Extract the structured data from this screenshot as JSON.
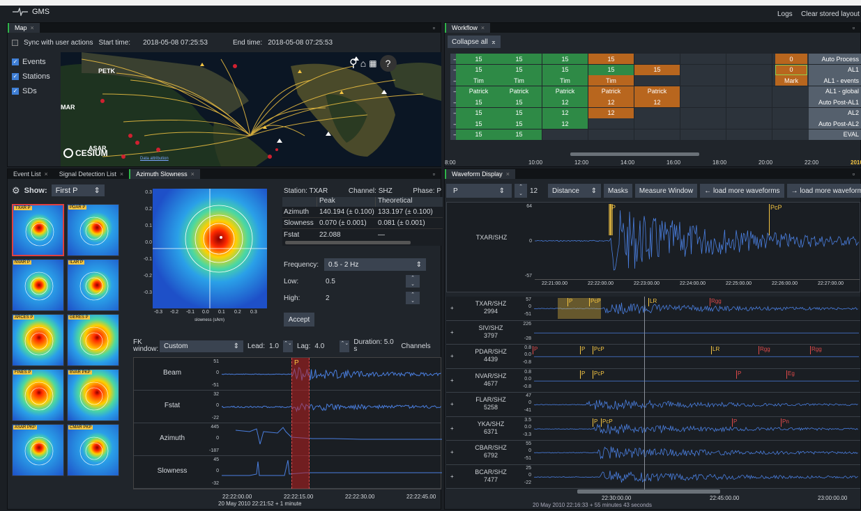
{
  "app": {
    "title": "GMS",
    "logs": "Logs",
    "clear": "Clear stored layout"
  },
  "map": {
    "tab": "Map",
    "sync_label": "Sync with user actions",
    "start_label": "Start time:",
    "start_value": "2018-05-08 07:25:53",
    "end_label": "End time:",
    "end_value": "2018-05-08 07:25:53",
    "layers": [
      "Events",
      "Stations",
      "SDs"
    ],
    "cesium": "CESIUM",
    "attribution": "Data attribution",
    "station_labels": [
      "PETK",
      "MAR",
      "ASAR",
      "ASAR"
    ]
  },
  "workflow": {
    "tab": "Workflow",
    "collapse": "Collapse all",
    "rows": [
      {
        "name": "Auto Process",
        "cells": [
          "15",
          "15",
          "15",
          "15",
          "",
          "",
          "",
          "",
          "0"
        ]
      },
      {
        "name": "AL1",
        "cells": [
          "15",
          "15",
          "15",
          "15",
          "15",
          "",
          "",
          "",
          "0"
        ]
      },
      {
        "name": "AL1 - events",
        "cells": [
          "Tim",
          "Tim",
          "Tim",
          "Tim",
          "",
          "",
          "",
          "",
          "Mark"
        ]
      },
      {
        "name": "AL1 - global",
        "cells": [
          "Patrick",
          "Patrick",
          "Patrick",
          "Patrick",
          "Patrick",
          "",
          "",
          "",
          ""
        ]
      },
      {
        "name": "Auto Post-AL1",
        "cells": [
          "15",
          "15",
          "12",
          "12",
          "12",
          "",
          "",
          "",
          ""
        ]
      },
      {
        "name": "AL2",
        "cells": [
          "15",
          "15",
          "12",
          "12",
          "",
          "",
          "",
          "",
          ""
        ]
      },
      {
        "name": "Auto Post-AL2",
        "cells": [
          "15",
          "15",
          "12",
          "",
          "",
          "",
          "",
          "",
          ""
        ]
      },
      {
        "name": "EVAL",
        "cells": [
          "15",
          "15",
          "",
          "",
          "",
          "",
          "",
          "",
          ""
        ]
      }
    ],
    "times": [
      "8:00",
      "10:00",
      "12:00",
      "14:00",
      "16:00",
      "18:00",
      "20:00",
      "22:00",
      "2010"
    ]
  },
  "left_tabs": [
    "Event List",
    "Signal Detection List",
    "Azimuth Slowness"
  ],
  "azslow": {
    "show_label": "Show:",
    "show_value": "First P",
    "thumbs": [
      "TXAR P",
      "PDAR P",
      "NVAR P",
      "ILAR P",
      "ARCES P",
      "GERES P",
      "FINES P",
      "BVAR PKP",
      "ASAR PKP",
      "CMAR PKP"
    ],
    "yticks": [
      "0.3",
      "0.2",
      "0.1",
      "0.0",
      "-0.1",
      "-0.2",
      "-0.3"
    ],
    "xticks": [
      "-0.3",
      "-0.2",
      "-0.1",
      "0.0",
      "0.1",
      "0.2",
      "0.3"
    ],
    "xunit": "slowness (s/km)",
    "station": "Station: TXAR",
    "channel": "Channel: SHZ",
    "phase": "Phase: P",
    "table": {
      "headers": [
        "",
        "Peak",
        "Theoretical"
      ],
      "rows": [
        [
          "Azimuth",
          "140.194 (± 0.100)",
          "133.197 (± 0.100)"
        ],
        [
          "Slowness",
          "0.070 (± 0.001)",
          "0.081 (± 0.001)"
        ],
        [
          "Fstat",
          "22.088",
          "—"
        ]
      ]
    },
    "freq_label": "Frequency:",
    "freq_value": "0.5 - 2 Hz",
    "low_label": "Low:",
    "low_value": "0.5",
    "high_label": "High:",
    "high_value": "2",
    "accept": "Accept",
    "fk_label": "FK window:",
    "fk_value": "Custom",
    "lead_label": "Lead:",
    "lead_value": "1.0",
    "lag_label": "Lag:",
    "lag_value": "4.0",
    "duration": "Duration: 5.0 s",
    "channels": "Channels",
    "traces": [
      {
        "name": "Beam",
        "ticks": [
          "51",
          "0",
          "-51"
        ]
      },
      {
        "name": "Fstat",
        "ticks": [
          "32",
          "0",
          "-22"
        ]
      },
      {
        "name": "Azimuth",
        "ticks": [
          "445",
          "0",
          "-187"
        ]
      },
      {
        "name": "Slowness",
        "ticks": [
          "45",
          "0",
          "-32"
        ]
      }
    ],
    "marker": "P",
    "times": [
      "22:22:00.00",
      "22:22:15.00",
      "22:22:30.00",
      "22:22:45.00"
    ],
    "footer": "20 May 2010 22:21:52 + 1 minute"
  },
  "waveform": {
    "tab": "Waveform Display",
    "phase": "P",
    "count": "12",
    "sort": "Distance",
    "masks": "Masks",
    "measure": "Measure Window",
    "load_prev": "← load more waveforms",
    "load_next": "→ load more waveforms",
    "top": {
      "name": "TXAR/SHZ",
      "ticks": [
        "64",
        "0",
        "-57"
      ],
      "markers": [
        "P",
        "PcP"
      ],
      "times": [
        "22:21:00.00",
        "22:22:00.00",
        "22:23:00.00",
        "22:24:00.00",
        "22:25:00.00",
        "22:26:00.00",
        "22:27:00.00"
      ]
    },
    "channels": [
      {
        "name": "TXAR/SHZ",
        "dist": "2994",
        "ticks": [
          "57",
          "0",
          "-51"
        ],
        "markers": [
          "P",
          "PcP",
          "LR",
          "Rgg"
        ]
      },
      {
        "name": "SIV/SHZ",
        "dist": "3797",
        "ticks": [
          "226",
          "",
          "-28"
        ],
        "markers": []
      },
      {
        "name": "PDAR/SHZ",
        "dist": "4439",
        "ticks": [
          "0.8",
          "0.0",
          "-0.8"
        ],
        "markers": [
          "P",
          "P",
          "PcP",
          "LR",
          "Rgg",
          "Rgg"
        ]
      },
      {
        "name": "NVAR/SHZ",
        "dist": "4677",
        "ticks": [
          "0.8",
          "0.0",
          "-0.8"
        ],
        "markers": [
          "P",
          "PcP",
          "P",
          "Eg"
        ]
      },
      {
        "name": "FLAR/SHZ",
        "dist": "5258",
        "ticks": [
          "47",
          "0",
          "-41"
        ],
        "markers": []
      },
      {
        "name": "YKA/SHZ",
        "dist": "6371",
        "ticks": [
          "3.5",
          "0.0",
          "-3.3"
        ],
        "markers": [
          "P",
          "PcP",
          "P",
          "Pn"
        ]
      },
      {
        "name": "CBAR/SHZ",
        "dist": "6792",
        "ticks": [
          "55",
          "0",
          "-51"
        ],
        "markers": []
      },
      {
        "name": "BCAR/SHZ",
        "dist": "7477",
        "ticks": [
          "25",
          "0",
          "-22"
        ],
        "markers": []
      }
    ],
    "times": [
      "22:30:00.00",
      "22:45:00.00",
      "23:00:00.00"
    ],
    "footer": "20 May 2010 22:16:33 + 55 minutes 43 seconds"
  },
  "colors": {
    "accent": "#2fb54a",
    "green": "#2e8a46",
    "orange": "#b8661e",
    "wave": "#4a7fe0",
    "marker_yellow": "#f5c542",
    "marker_red": "#e04a4a"
  }
}
